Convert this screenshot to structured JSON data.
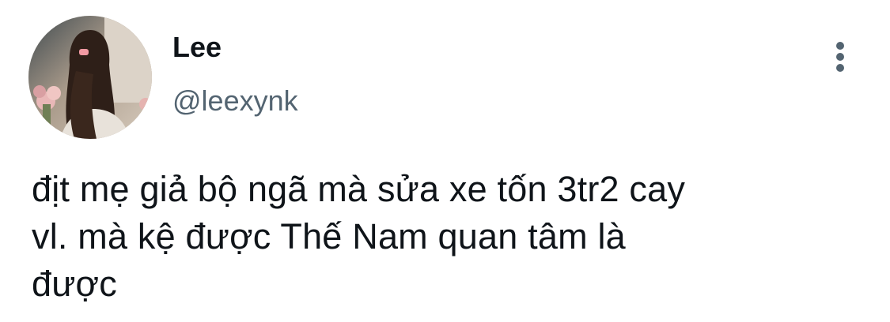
{
  "author": {
    "display_name": "Lee",
    "handle": "@leexynk",
    "avatar_icon": "profile-photo"
  },
  "menu": {
    "icon": "more-vertical-icon"
  },
  "tweet": {
    "lines": [
      "địt mẹ giả bộ ngã mà sửa xe tốn 3tr2 cay",
      "vl. mà kệ được Thế Nam quan tâm là",
      "được"
    ]
  },
  "colors": {
    "text": "#0f1419",
    "secondary": "#536471",
    "background": "#ffffff"
  }
}
